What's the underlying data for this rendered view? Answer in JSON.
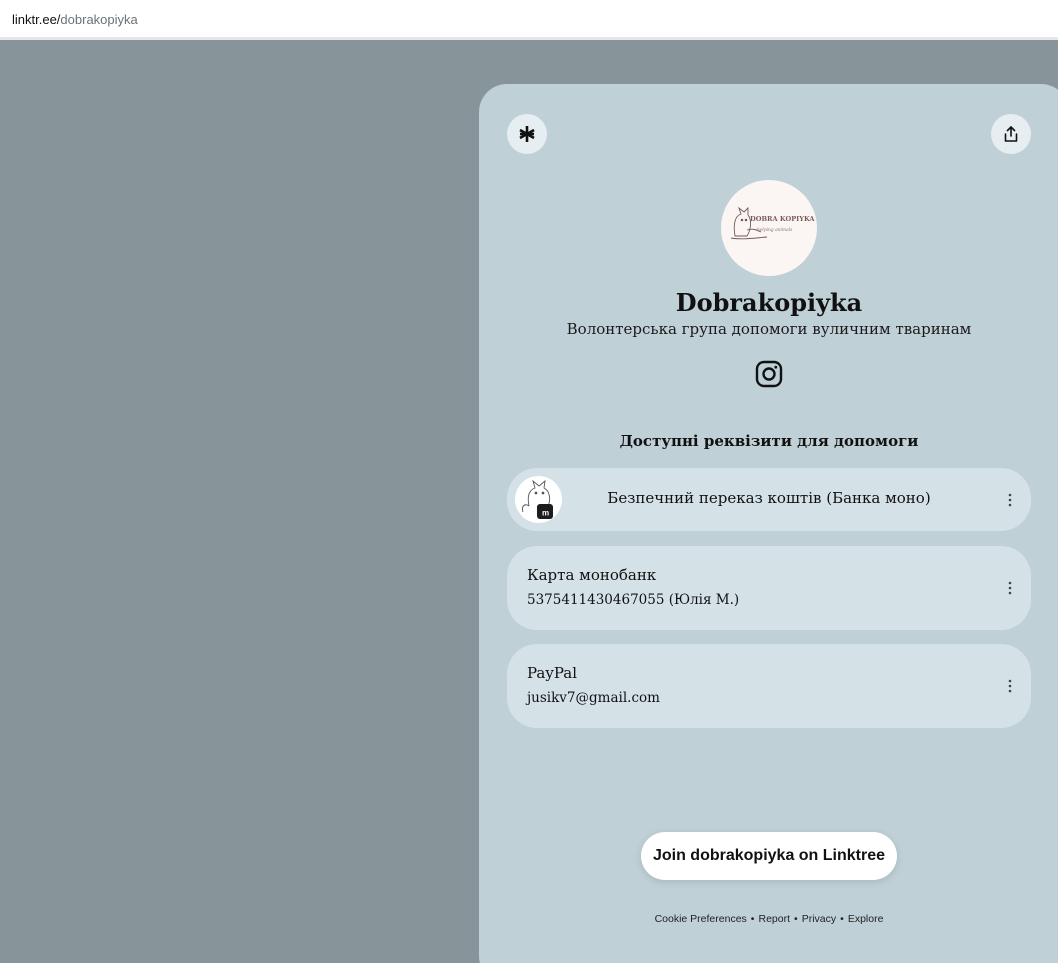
{
  "browser": {
    "url_host": "linktr.ee/",
    "url_path": "dobrakopiyka"
  },
  "header": {
    "logo_icon": "linktree-asterisk-icon",
    "share_icon": "share-icon"
  },
  "profile": {
    "avatar_text_top": "DOBRA KOPIYKA",
    "avatar_text_bottom": "helping animals",
    "name": "Dobrakopiyka",
    "bio": "Волонтерська група допомоги вуличним тваринам",
    "social_icon": "instagram-icon"
  },
  "section": {
    "title": "Доступні реквізити для допомоги"
  },
  "links": [
    {
      "label": "Безпечний переказ коштів (Банка моно)",
      "thumb_badge": "m"
    },
    {
      "title": "Карта монобанк",
      "subtitle": "5375411430467055 (Юлія М.)"
    },
    {
      "title": "PayPal",
      "subtitle": "jusikv7@gmail.com"
    }
  ],
  "join": {
    "label": "Join dobrakopiyka on Linktree"
  },
  "footer": {
    "items": [
      "Cookie Preferences",
      "Report",
      "Privacy",
      "Explore"
    ],
    "separator": "•"
  },
  "colors": {
    "backdrop": "#87949a",
    "panel": "#bfd0d7",
    "card": "#d4e2e8"
  }
}
